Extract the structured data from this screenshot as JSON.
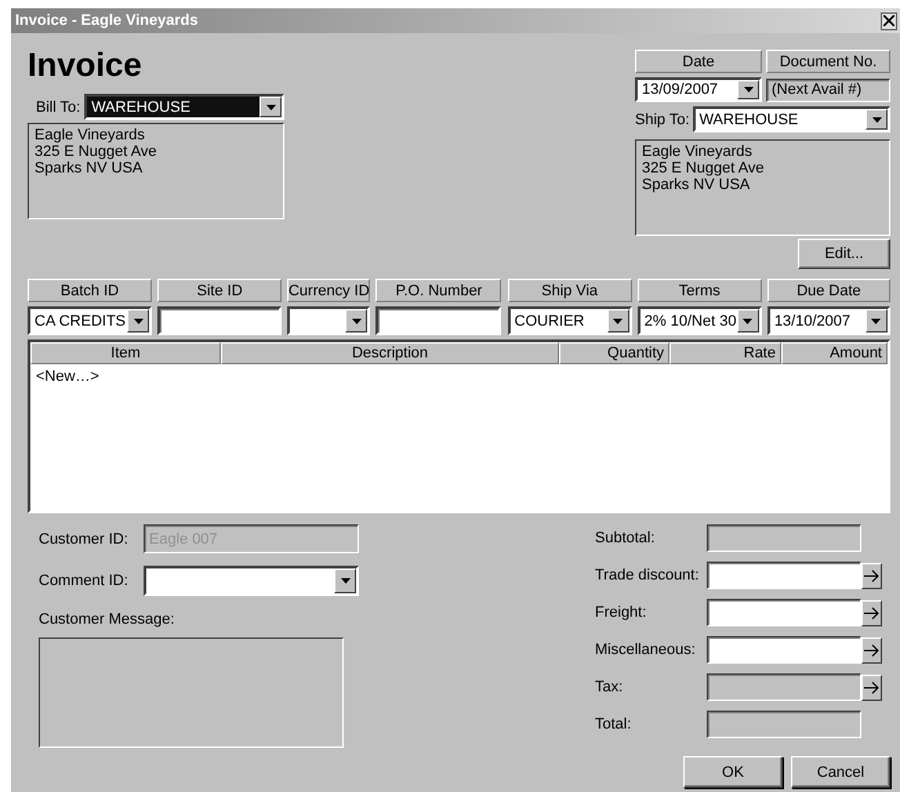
{
  "window": {
    "title": "Invoice - Eagle Vineyards"
  },
  "heading": "Invoice",
  "bill_to": {
    "label": "Bill To:",
    "value": "WAREHOUSE",
    "focused": true,
    "address": [
      "Eagle Vineyards",
      "325 E Nugget Ave",
      "Sparks NV  USA"
    ]
  },
  "date": {
    "label": "Date",
    "value": "13/09/2007"
  },
  "document_no": {
    "label": "Document No.",
    "value": "(Next Avail #)"
  },
  "ship_to": {
    "label": "Ship To:",
    "value": "WAREHOUSE",
    "focused": false,
    "address": [
      "Eagle Vineyards",
      "325 E Nugget Ave",
      "Sparks NV  USA"
    ]
  },
  "edit_button": "Edit...",
  "header_fields": [
    {
      "label": "Batch ID",
      "value": "CA CREDITS",
      "kind": "dropdown"
    },
    {
      "label": "Site ID",
      "kind": "text"
    },
    {
      "label": "Currency ID",
      "kind": "dropdown"
    },
    {
      "label": "P.O. Number",
      "kind": "text"
    },
    {
      "label": "Ship Via",
      "value": "COURIER",
      "kind": "dropdown"
    },
    {
      "label": "Terms",
      "value": "2% 10/Net 30",
      "kind": "dropdown"
    },
    {
      "label": "Due Date",
      "value": "13/10/2007",
      "kind": "dropdown"
    }
  ],
  "table": {
    "columns": [
      "Item",
      "Description",
      "Quantity",
      "Rate",
      "Amount"
    ],
    "rows": [
      {
        "item": "<New…>"
      }
    ]
  },
  "customer_id": {
    "label": "Customer ID:",
    "value": "Eagle 007",
    "disabled": true
  },
  "comment_id": {
    "label": "Comment ID:"
  },
  "customer_message": {
    "label": "Customer Message:"
  },
  "totals": [
    {
      "label": "Subtotal:",
      "disabled": true,
      "kind": "plain"
    },
    {
      "label": "Trade discount:",
      "disabled": false,
      "kind": "arrow"
    },
    {
      "label": "Freight:",
      "disabled": false,
      "kind": "arrow"
    },
    {
      "label": "Miscellaneous:",
      "disabled": false,
      "kind": "arrow"
    },
    {
      "label": "Tax:",
      "disabled": true,
      "kind": "arrow"
    },
    {
      "label": "Total:",
      "disabled": true,
      "kind": "plain"
    }
  ],
  "buttons": [
    "OK",
    "Cancel"
  ]
}
